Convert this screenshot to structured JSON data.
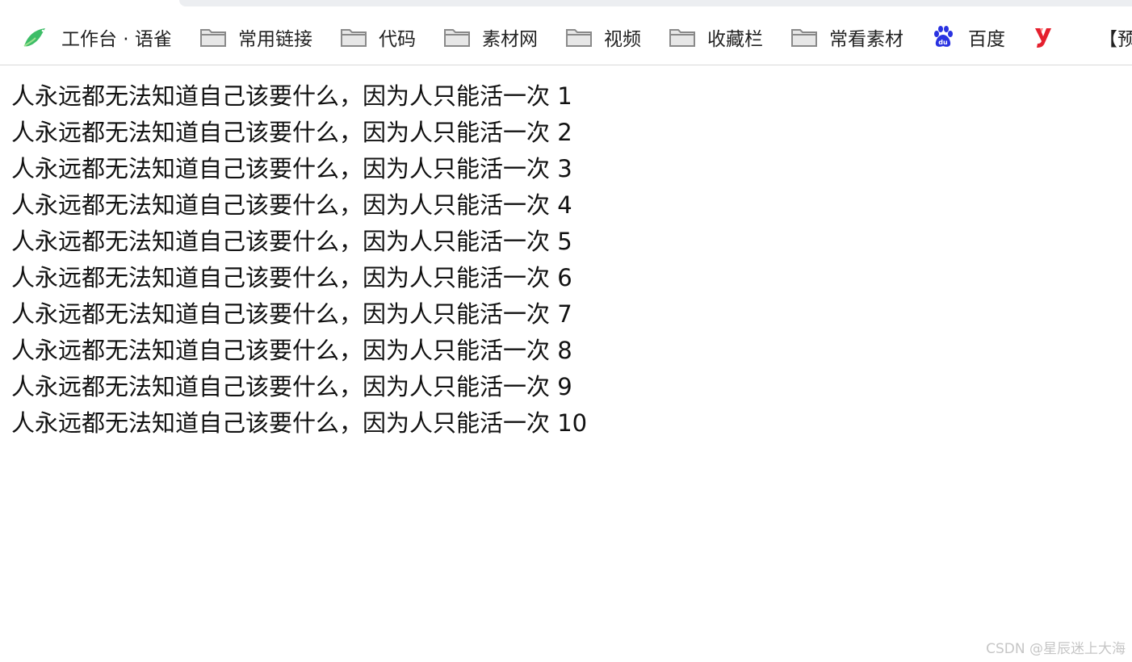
{
  "bookmarks": [
    {
      "label": "工作台 · 语雀",
      "icon": "yuque-bird-icon"
    },
    {
      "label": "常用链接",
      "icon": "folder-icon"
    },
    {
      "label": "代码",
      "icon": "folder-icon"
    },
    {
      "label": "素材网",
      "icon": "folder-icon"
    },
    {
      "label": "视频",
      "icon": "folder-icon"
    },
    {
      "label": "收藏栏",
      "icon": "folder-icon"
    },
    {
      "label": "常看素材",
      "icon": "folder-icon"
    },
    {
      "label": "百度",
      "icon": "baidu-paw-icon"
    },
    {
      "label": "",
      "icon": "youzan-y-icon"
    },
    {
      "label": "【预约",
      "icon": ""
    }
  ],
  "lines": [
    "人永远都无法知道自己该要什么，因为人只能活一次 1",
    "人永远都无法知道自己该要什么，因为人只能活一次 2",
    "人永远都无法知道自己该要什么，因为人只能活一次 3",
    "人永远都无法知道自己该要什么，因为人只能活一次 4",
    "人永远都无法知道自己该要什么，因为人只能活一次 5",
    "人永远都无法知道自己该要什么，因为人只能活一次 6",
    "人永远都无法知道自己该要什么，因为人只能活一次 7",
    "人永远都无法知道自己该要什么，因为人只能活一次 8",
    "人永远都无法知道自己该要什么，因为人只能活一次 9",
    "人永远都无法知道自己该要什么，因为人只能活一次 10"
  ],
  "watermark": "CSDN @星辰迷上大海",
  "colors": {
    "yuque_green": "#3dbd67",
    "folder_gray": "#8a8a8a",
    "baidu_blue": "#2932e1",
    "youzan_red": "#e5202e"
  }
}
